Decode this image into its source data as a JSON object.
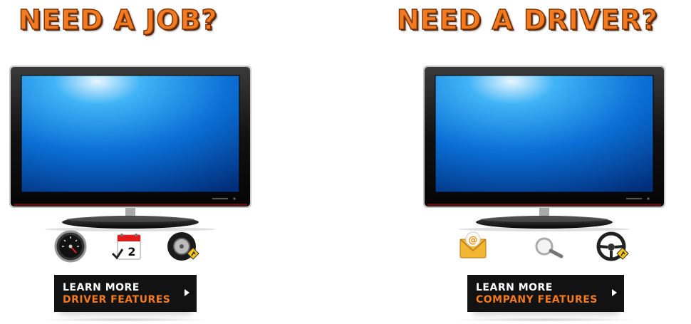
{
  "left": {
    "title": "NEED A JOB?",
    "button": {
      "line1": "LEARN MORE",
      "line2": "DRIVER  FEATURES"
    },
    "icons": [
      "speedometer-icon",
      "calendar-icon",
      "tire-icon"
    ],
    "calendar_day": "2"
  },
  "right": {
    "title": "NEED A DRIVER?",
    "button": {
      "line1": "LEARN MORE",
      "line2": "COMPANY  FEATURES"
    },
    "icons": [
      "email-icon",
      "magnifier-icon",
      "steering-wheel-icon"
    ]
  },
  "colors": {
    "accent_orange": "#f47a1f",
    "button_bg": "#121212",
    "screen_blue": "#0a6fd6"
  }
}
